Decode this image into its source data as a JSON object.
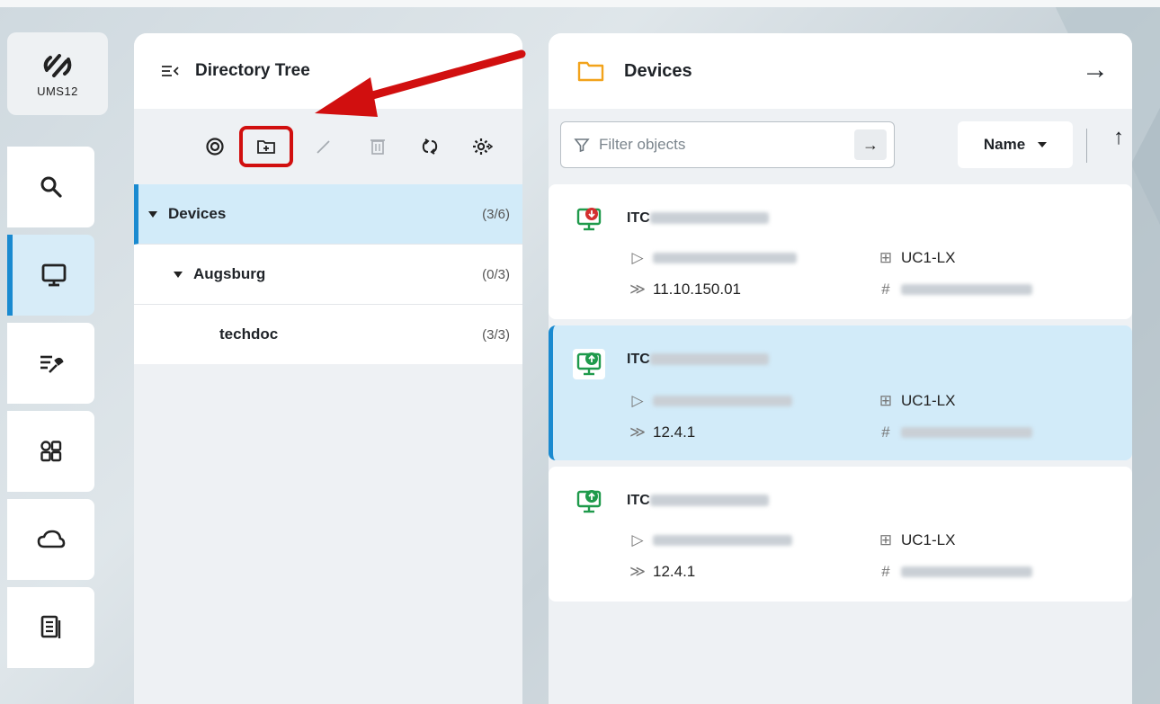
{
  "rail": {
    "logo_text": "UMS12",
    "items": [
      {
        "name": "search",
        "icon": "search-icon"
      },
      {
        "name": "devices",
        "icon": "monitor-icon",
        "active": true
      },
      {
        "name": "configuration",
        "icon": "tools-icon"
      },
      {
        "name": "apps",
        "icon": "apps-grid-icon"
      },
      {
        "name": "cloud",
        "icon": "cloud-icon"
      },
      {
        "name": "logs",
        "icon": "document-icon"
      }
    ]
  },
  "tree": {
    "title": "Directory Tree",
    "toolbar": [
      "target-icon",
      "new-folder-icon",
      "edit-icon",
      "delete-icon",
      "refresh-icon",
      "settings-icon"
    ],
    "rows": [
      {
        "label": "Devices",
        "count": "(3/6)",
        "selected": true
      },
      {
        "label": "Augsburg",
        "count": "(0/3)"
      },
      {
        "label": "techdoc",
        "count": "(3/3)"
      }
    ]
  },
  "devices": {
    "title": "Devices",
    "filter_placeholder": "Filter objects",
    "sort_label": "Name",
    "items": [
      {
        "name_prefix": "ITC",
        "firmware": "11.10.150.01",
        "product": "UC1-LX",
        "status": "down",
        "selected": false
      },
      {
        "name_prefix": "ITC",
        "firmware": "12.4.1",
        "product": "UC1-LX",
        "status": "up",
        "selected": true
      },
      {
        "name_prefix": "ITC",
        "firmware": "12.4.1",
        "product": "UC1-LX",
        "status": "up",
        "selected": false
      }
    ]
  },
  "colors": {
    "accent": "#1a8ad0",
    "selection": "#d2ebf9",
    "annotation": "#d10f0f",
    "status_up": "#1f9a4b",
    "status_down": "#d32f2f",
    "folder": "#f2a31b"
  }
}
